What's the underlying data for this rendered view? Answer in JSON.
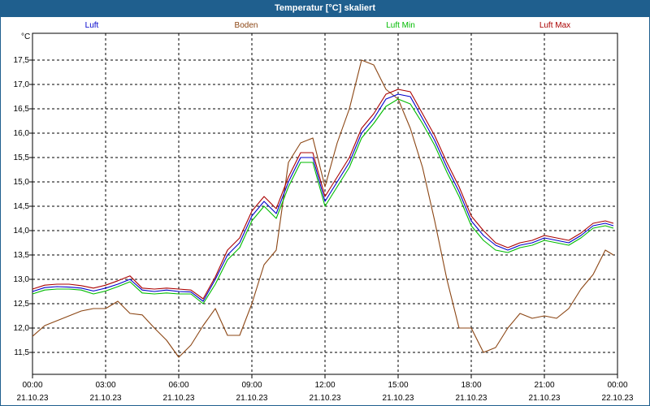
{
  "window": {
    "title": "Temperatur [°C] skaliert"
  },
  "chart_data": {
    "type": "line",
    "title": "Temperatur [°C] skaliert",
    "unit": "°C",
    "xlabel": "",
    "ylabel": "°C",
    "ylim": [
      11.05,
      18.05
    ],
    "xlim_hours": [
      0,
      24
    ],
    "grid": true,
    "legend_position": "top",
    "y_ticks": [
      "17,5",
      "17,0",
      "16,5",
      "16,0",
      "15,5",
      "15,0",
      "14,5",
      "14,0",
      "13,5",
      "13,0",
      "12,5",
      "12,0",
      "11,5"
    ],
    "y_tick_values": [
      17.5,
      17.0,
      16.5,
      16.0,
      15.5,
      15.0,
      14.5,
      14.0,
      13.5,
      13.0,
      12.5,
      12.0,
      11.5
    ],
    "x_ticks": [
      {
        "time": "00:00",
        "date": "21.10.23",
        "h": 0
      },
      {
        "time": "03:00",
        "date": "21.10.23",
        "h": 3
      },
      {
        "time": "06:00",
        "date": "21.10.23",
        "h": 6
      },
      {
        "time": "09:00",
        "date": "21.10.23",
        "h": 9
      },
      {
        "time": "12:00",
        "date": "21.10.23",
        "h": 12
      },
      {
        "time": "15:00",
        "date": "21.10.23",
        "h": 15
      },
      {
        "time": "18:00",
        "date": "21.10.23",
        "h": 18
      },
      {
        "time": "21:00",
        "date": "21.10.23",
        "h": 21
      },
      {
        "time": "00:00",
        "date": "22.10.23",
        "h": 24
      }
    ],
    "x": [
      "00:00",
      "00:30",
      "01:00",
      "01:30",
      "02:00",
      "02:30",
      "03:00",
      "03:30",
      "04:00",
      "04:30",
      "05:00",
      "05:30",
      "06:00",
      "06:30",
      "07:00",
      "07:30",
      "08:00",
      "08:30",
      "09:00",
      "09:30",
      "10:00",
      "10:30",
      "11:00",
      "11:30",
      "12:00",
      "12:30",
      "13:00",
      "13:30",
      "14:00",
      "14:30",
      "15:00",
      "15:30",
      "16:00",
      "16:30",
      "17:00",
      "17:30",
      "18:00",
      "18:30",
      "19:00",
      "19:30",
      "20:00",
      "20:30",
      "21:00",
      "21:30",
      "22:00",
      "22:30",
      "23:00",
      "23:30",
      "23:50"
    ],
    "series": [
      {
        "name": "Luft",
        "color": "#0000cc",
        "values": [
          12.75,
          12.83,
          12.85,
          12.84,
          12.82,
          12.76,
          12.82,
          12.9,
          13.0,
          12.78,
          12.75,
          12.78,
          12.75,
          12.74,
          12.55,
          13.0,
          13.5,
          13.75,
          14.3,
          14.6,
          14.35,
          15.0,
          15.5,
          15.5,
          14.6,
          15.0,
          15.4,
          16.0,
          16.3,
          16.7,
          16.8,
          16.75,
          16.3,
          15.85,
          15.3,
          14.8,
          14.2,
          13.9,
          13.7,
          13.6,
          13.7,
          13.75,
          13.85,
          13.8,
          13.75,
          13.9,
          14.1,
          14.15,
          14.1
        ]
      },
      {
        "name": "Boden",
        "color": "#8b4513",
        "values": [
          11.83,
          12.05,
          12.15,
          12.25,
          12.35,
          12.4,
          12.4,
          12.55,
          12.3,
          12.27,
          12.0,
          11.75,
          11.4,
          11.65,
          12.05,
          12.4,
          11.85,
          11.85,
          12.5,
          13.3,
          13.6,
          15.4,
          15.8,
          15.9,
          14.9,
          15.8,
          16.5,
          17.5,
          17.4,
          16.9,
          16.7,
          16.1,
          15.3,
          14.2,
          13.0,
          12.0,
          12.0,
          11.5,
          11.6,
          12.0,
          12.3,
          12.2,
          12.25,
          12.2,
          12.4,
          12.8,
          13.1,
          13.6,
          13.5
        ]
      },
      {
        "name": "Luft Min",
        "color": "#00bb00",
        "values": [
          12.7,
          12.78,
          12.8,
          12.8,
          12.78,
          12.7,
          12.76,
          12.85,
          12.95,
          12.72,
          12.7,
          12.72,
          12.7,
          12.7,
          12.5,
          12.9,
          13.4,
          13.65,
          14.2,
          14.5,
          14.25,
          14.9,
          15.4,
          15.4,
          14.5,
          14.9,
          15.3,
          15.9,
          16.2,
          16.55,
          16.7,
          16.6,
          16.2,
          15.75,
          15.2,
          14.7,
          14.1,
          13.8,
          13.6,
          13.55,
          13.65,
          13.7,
          13.8,
          13.75,
          13.7,
          13.85,
          14.05,
          14.1,
          14.05
        ]
      },
      {
        "name": "Luft Max",
        "color": "#aa0000",
        "values": [
          12.8,
          12.88,
          12.9,
          12.9,
          12.87,
          12.82,
          12.88,
          12.97,
          13.07,
          12.82,
          12.8,
          12.82,
          12.8,
          12.78,
          12.6,
          13.05,
          13.6,
          13.85,
          14.4,
          14.7,
          14.45,
          15.1,
          15.6,
          15.6,
          14.7,
          15.1,
          15.5,
          16.1,
          16.4,
          16.8,
          16.9,
          16.85,
          16.4,
          15.95,
          15.4,
          14.9,
          14.3,
          14.0,
          13.75,
          13.65,
          13.75,
          13.8,
          13.9,
          13.85,
          13.8,
          13.95,
          14.15,
          14.2,
          14.15
        ]
      }
    ]
  }
}
